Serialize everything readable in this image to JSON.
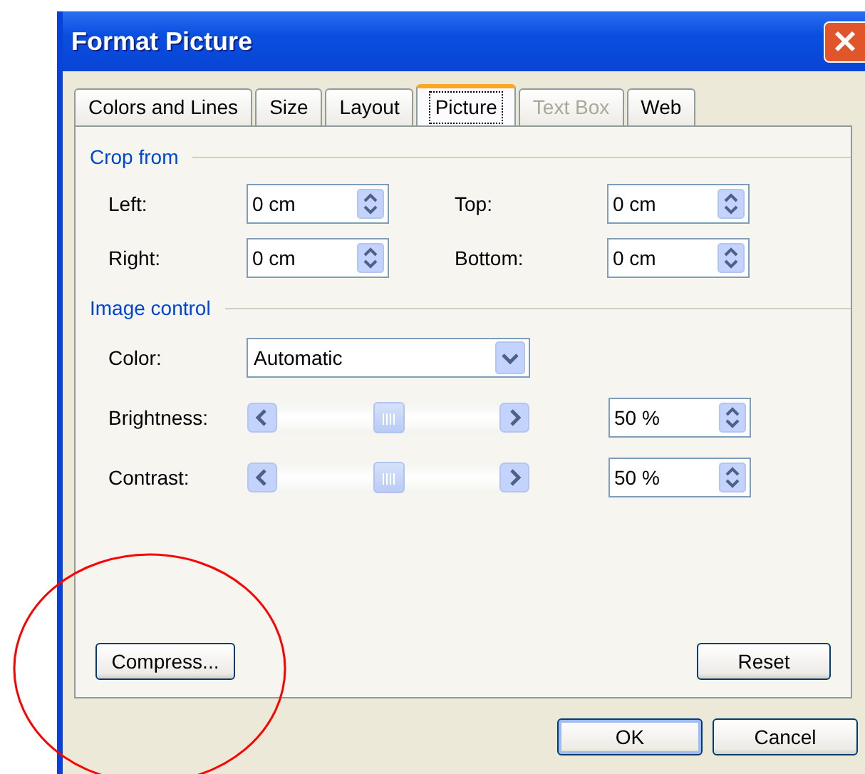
{
  "window": {
    "title": "Format Picture"
  },
  "tabs": [
    {
      "label": "Colors and Lines",
      "selected": false,
      "disabled": false
    },
    {
      "label": "Size",
      "selected": false,
      "disabled": false
    },
    {
      "label": "Layout",
      "selected": false,
      "disabled": false
    },
    {
      "label": "Picture",
      "selected": true,
      "disabled": false
    },
    {
      "label": "Text Box",
      "selected": false,
      "disabled": true
    },
    {
      "label": "Web",
      "selected": false,
      "disabled": false
    }
  ],
  "crop": {
    "title": "Crop from",
    "fields": [
      {
        "label": "Left:",
        "value": "0 cm"
      },
      {
        "label": "Top:",
        "value": "0 cm"
      },
      {
        "label": "Right:",
        "value": "0 cm"
      },
      {
        "label": "Bottom:",
        "value": "0 cm"
      }
    ]
  },
  "image_control": {
    "title": "Image control",
    "rows": [
      {
        "kind": "dropdown",
        "label": "Color:",
        "value": "Automatic"
      },
      {
        "kind": "slider",
        "label": "Brightness:",
        "level": 0.5,
        "value": "50 %"
      },
      {
        "kind": "slider",
        "label": "Contrast:",
        "level": 0.5,
        "value": "50 %"
      }
    ]
  },
  "panel_buttons": [
    "Compress...",
    "Reset"
  ],
  "dialog_buttons": [
    {
      "label": "OK",
      "default": true
    },
    {
      "label": "Cancel",
      "default": false
    }
  ],
  "annotation": {
    "kind": "ellipse",
    "color": "#ff0000"
  }
}
